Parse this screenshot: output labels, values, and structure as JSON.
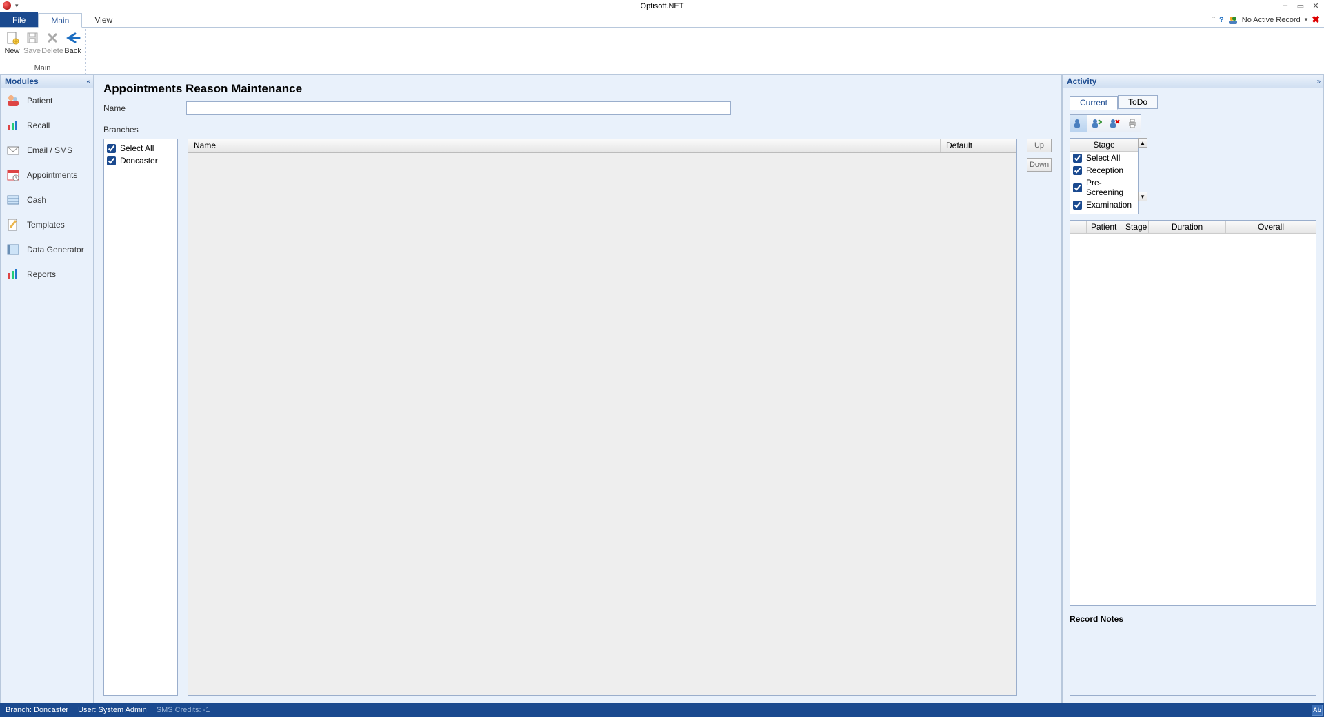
{
  "app": {
    "title": "Optisoft.NET",
    "no_active_record": "No Active Record",
    "window_controls": {
      "min": "–",
      "max": "▭",
      "close": "✕"
    }
  },
  "menubar": {
    "file": "File",
    "main": "Main",
    "view": "View"
  },
  "ribbon": {
    "group_label": "Main",
    "buttons": {
      "new": "New",
      "save": "Save",
      "delete": "Delete",
      "back": "Back"
    }
  },
  "modules": {
    "header": "Modules",
    "items": [
      {
        "label": "Patient"
      },
      {
        "label": "Recall"
      },
      {
        "label": "Email / SMS"
      },
      {
        "label": "Appointments"
      },
      {
        "label": "Cash"
      },
      {
        "label": "Templates"
      },
      {
        "label": "Data Generator"
      },
      {
        "label": "Reports"
      }
    ]
  },
  "main": {
    "title": "Appointments Reason Maintenance",
    "name_label": "Name",
    "name_value": "",
    "branches_label": "Branches",
    "branch_checks": [
      {
        "label": "Select All",
        "checked": true
      },
      {
        "label": "Doncaster",
        "checked": true
      }
    ],
    "grid": {
      "columns": {
        "name": "Name",
        "default": "Default"
      }
    },
    "buttons": {
      "up": "Up",
      "down": "Down"
    }
  },
  "activity": {
    "header": "Activity",
    "tabs": {
      "current": "Current",
      "todo": "ToDo"
    },
    "stage_header": "Stage",
    "stage_checks": [
      {
        "label": "Select All",
        "checked": true
      },
      {
        "label": "Reception",
        "checked": true
      },
      {
        "label": "Pre-Screening",
        "checked": true
      },
      {
        "label": "Examination",
        "checked": true
      }
    ],
    "grid_columns": {
      "patient": "Patient",
      "stage": "Stage",
      "duration": "Duration",
      "overall": "Overall"
    },
    "record_notes_title": "Record Notes"
  },
  "statusbar": {
    "branch": "Branch: Doncaster",
    "user": "User: System Admin",
    "sms": "SMS Credits: -1",
    "ab": "Ab"
  }
}
